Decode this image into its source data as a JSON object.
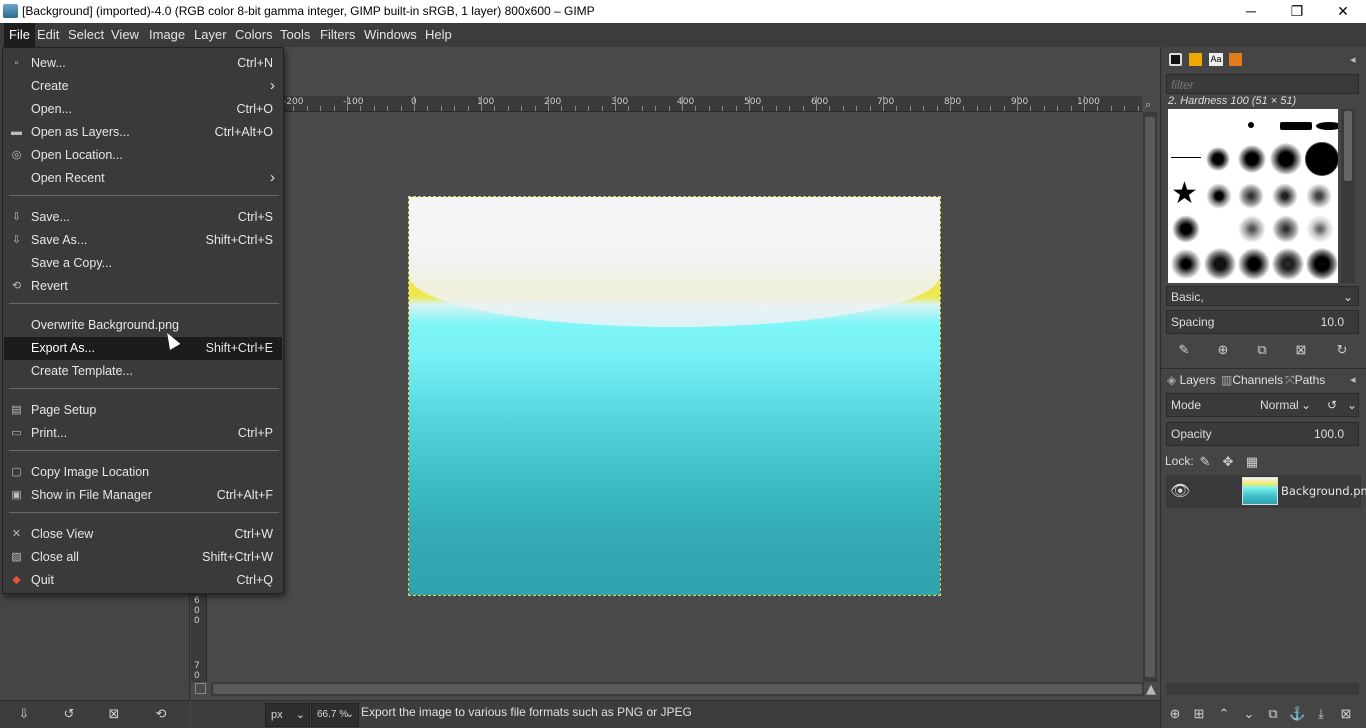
{
  "window": {
    "title": "[Background] (imported)-4.0 (RGB color 8-bit gamma integer, GIMP built-in sRGB, 1 layer) 800x600 – GIMP",
    "minimize": "─",
    "maximize": "❐",
    "close": "✕"
  },
  "menubar": {
    "items": [
      "File",
      "Edit",
      "Select",
      "View",
      "Image",
      "Layer",
      "Colors",
      "Tools",
      "Filters",
      "Windows",
      "Help"
    ]
  },
  "file_menu": {
    "items": [
      {
        "label": "New...",
        "shortcut": "Ctrl+N",
        "icon": "new-icon"
      },
      {
        "label": "Create",
        "shortcut": "",
        "icon": "",
        "submenu": true
      },
      {
        "label": "Open...",
        "shortcut": "Ctrl+O",
        "icon": "open-icon"
      },
      {
        "label": "Open as Layers...",
        "shortcut": "Ctrl+Alt+O",
        "icon": "open-layers-icon"
      },
      {
        "label": "Open Location...",
        "shortcut": "",
        "icon": "globe-icon"
      },
      {
        "label": "Open Recent",
        "shortcut": "",
        "icon": "",
        "submenu": true
      },
      {
        "label": "Save...",
        "shortcut": "Ctrl+S",
        "icon": "save-icon"
      },
      {
        "label": "Save As...",
        "shortcut": "Shift+Ctrl+S",
        "icon": "save-as-icon"
      },
      {
        "label": "Save a Copy...",
        "shortcut": "",
        "icon": ""
      },
      {
        "label": "Revert",
        "shortcut": "",
        "icon": "revert-icon"
      },
      {
        "label": "Overwrite Background.png",
        "shortcut": "",
        "icon": ""
      },
      {
        "label": "Export As...",
        "shortcut": "Shift+Ctrl+E",
        "icon": ""
      },
      {
        "label": "Create Template...",
        "shortcut": "",
        "icon": ""
      },
      {
        "label": "Page Setup",
        "shortcut": "",
        "icon": "page-setup-icon"
      },
      {
        "label": "Print...",
        "shortcut": "Ctrl+P",
        "icon": "print-icon"
      },
      {
        "label": "Copy Image Location",
        "shortcut": "",
        "icon": "copy-location-icon"
      },
      {
        "label": "Show in File Manager",
        "shortcut": "Ctrl+Alt+F",
        "icon": "file-manager-icon"
      },
      {
        "label": "Close View",
        "shortcut": "Ctrl+W",
        "icon": "close-view-icon"
      },
      {
        "label": "Close all",
        "shortcut": "Shift+Ctrl+W",
        "icon": "close-all-icon"
      },
      {
        "label": "Quit",
        "shortcut": "Ctrl+Q",
        "icon": "quit-icon"
      }
    ],
    "highlighted": "Export As..."
  },
  "rulers": {
    "horizontal": [
      "-200",
      "-100",
      "0",
      "100",
      "200",
      "300",
      "400",
      "500",
      "600",
      "700",
      "800",
      "900",
      "1000"
    ],
    "vertical": [
      "6",
      "0",
      "0",
      "7",
      "0"
    ]
  },
  "status": {
    "unit": "px",
    "zoom": "66.7 %",
    "message": "Export the image to various file formats such as PNG or JPEG"
  },
  "brushes": {
    "filter_placeholder": "filter",
    "current": "2. Hardness 100 (51 × 51)",
    "preset": "Basic,",
    "spacing_label": "Spacing",
    "spacing_value": "10.0"
  },
  "layers_panel": {
    "tabs": [
      "Layers",
      "Channels",
      "Paths"
    ],
    "mode_label": "Mode",
    "mode_value": "Normal",
    "opacity_label": "Opacity",
    "opacity_value": "100.0",
    "lock_label": "Lock:",
    "layers": [
      {
        "name": "Background.png"
      }
    ]
  },
  "colors": {
    "menu_highlight": "#1c1c1c",
    "selection_border": "#e0d24a"
  }
}
